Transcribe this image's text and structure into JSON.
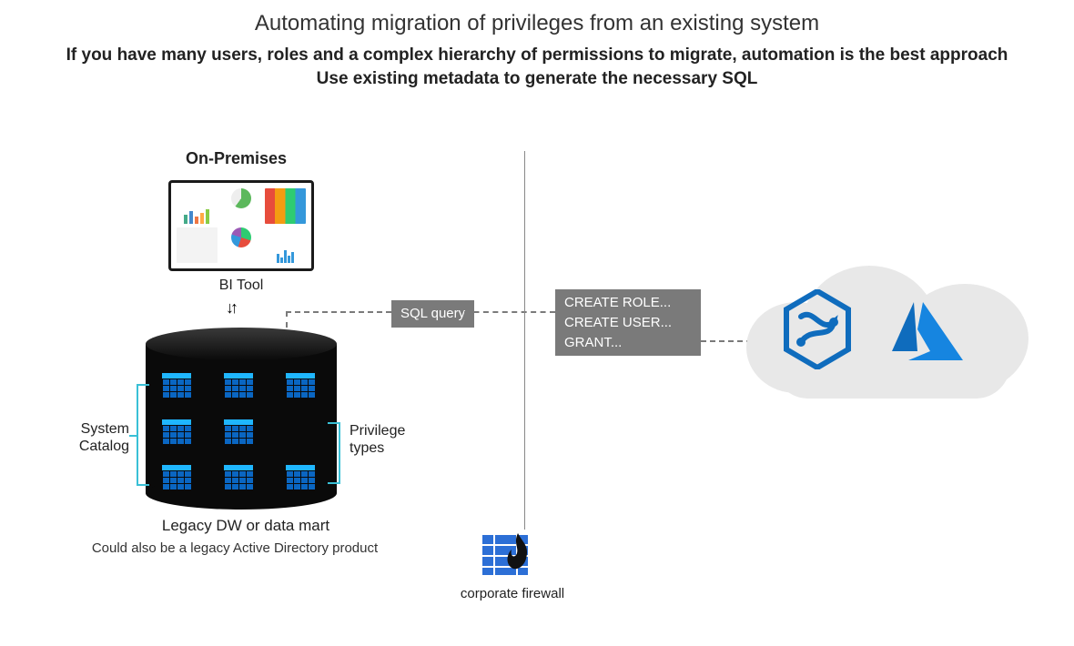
{
  "title": "Automating migration of privileges from an existing system",
  "subtitle1": "If you have many users, roles and a complex hierarchy of permissions to migrate, automation is the best approach",
  "subtitle2": "Use existing metadata to generate the necessary SQL",
  "onprem": {
    "heading": "On-Premises",
    "bi_tool_label": "BI Tool",
    "db_label": "Legacy DW or data mart",
    "db_note": "Could also be a legacy Active Directory product",
    "system_catalog_label": "System\nCatalog",
    "privilege_types_label": "Privilege\ntypes"
  },
  "flow": {
    "sql_query_label": "SQL query",
    "sql_statements": "CREATE ROLE...\nCREATE USER...\nGRANT..."
  },
  "firewall_label": "corporate firewall",
  "icons": {
    "synapse": "azure-synapse-icon",
    "azure": "azure-icon"
  },
  "colors": {
    "grey_box": "#7a7a7a",
    "dashed": "#7a7a7a",
    "bracket": "#39c0d6",
    "cloud": "#e8e8e8",
    "azure_blue": "#0f6cbd",
    "firewall_blue": "#2c6fd6"
  }
}
